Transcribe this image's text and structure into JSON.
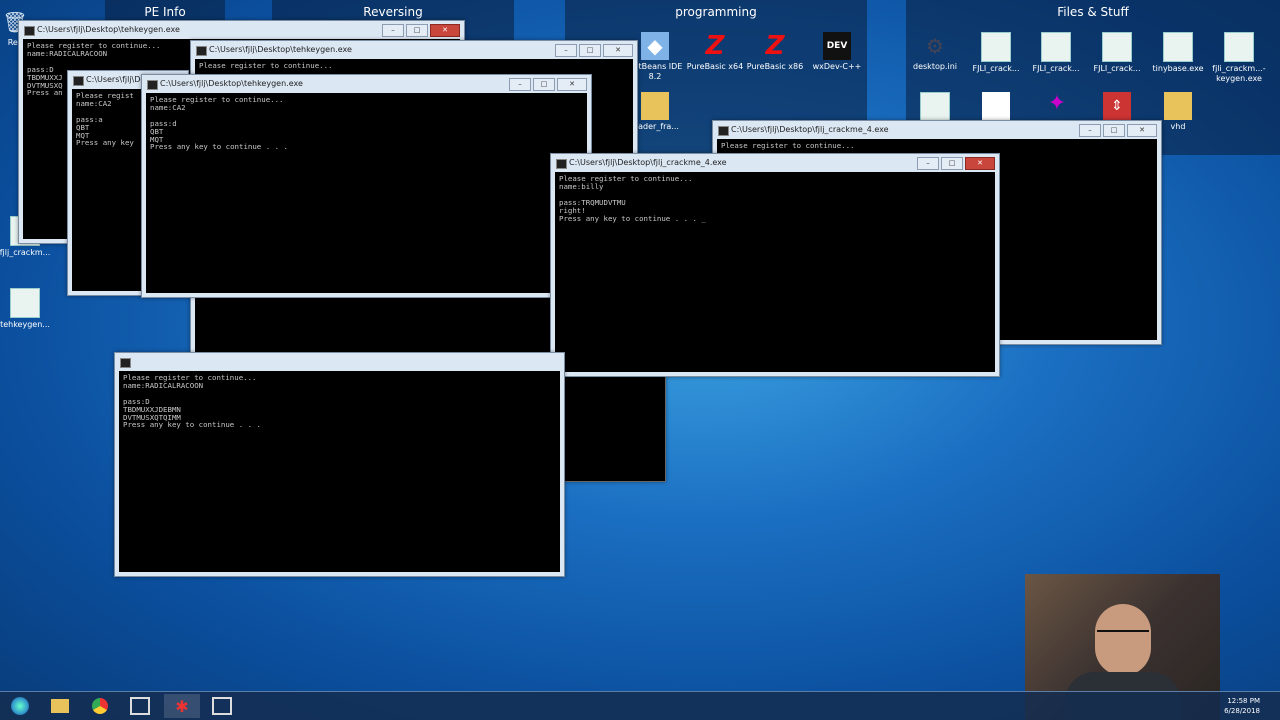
{
  "fences": {
    "pe_info": "PE Info",
    "reversing": "Reversing",
    "programming": "programming",
    "files": "Files & Stuff"
  },
  "prog_icons": [
    "NetBeans IDE 8.2",
    "PureBasic x64",
    "PureBasic x86",
    "wxDev-C++",
    "loader_fra..."
  ],
  "files_icons": [
    "desktop.ini",
    "FJLI_crack...",
    "FJLI_crack...",
    "FJLI_crack...",
    "tinybase.exe",
    "fjli_crackm...-keygen.exe",
    "vhd"
  ],
  "left_icons": [
    "Rec",
    "fjlj_crackm...",
    "tehkeygen..."
  ],
  "windows": {
    "w1": {
      "title": "C:\\Users\\fjlj\\Desktop\\tehkeygen.exe",
      "text": "Please register to continue...\nname:RADICALRACOON\n\npass:D\nTBDMUXXJ\nDVTMUSXQ\nPress an"
    },
    "w2": {
      "title": "C:\\Users\\fjlj\\Desktop\\tehkeygen.exe",
      "text": "Please register to continue..."
    },
    "w3": {
      "title": "C:\\Users\\fjlj\\De",
      "text": "Please regist\nname:CA2\n\npass:a\nQBT\nMQT\nPress any key"
    },
    "w4": {
      "title": "C:\\Users\\fjlj\\Desktop\\tehkeygen.exe",
      "text": "Please register to continue...\nname:CA2\n\npass:d\nQBT\nMQT\nPress any key to continue . . ."
    },
    "w5": {
      "title": "C:\\Users\\fjlj\\Desktop\\fjlj_crackme_4.exe",
      "text": "Please register to continue..."
    },
    "w6": {
      "title": "C:\\Users\\fjlj\\Desktop\\fjlj_crackme_4.exe",
      "text": "Please register to continue...\nname:billy\n\npass:TRQMUDVTMU\nright!\nPress any key to continue . . . _"
    },
    "w7": {
      "title": "",
      "text": "Please register to continue...\nname:RADICALRACOON\n\npass:D\nTBDMUXXJDEBMN\nDVTMUSXQTQIMM\nPress any key to continue . . ."
    }
  },
  "clock": {
    "time": "12:58 PM",
    "date": "6/28/2018"
  }
}
